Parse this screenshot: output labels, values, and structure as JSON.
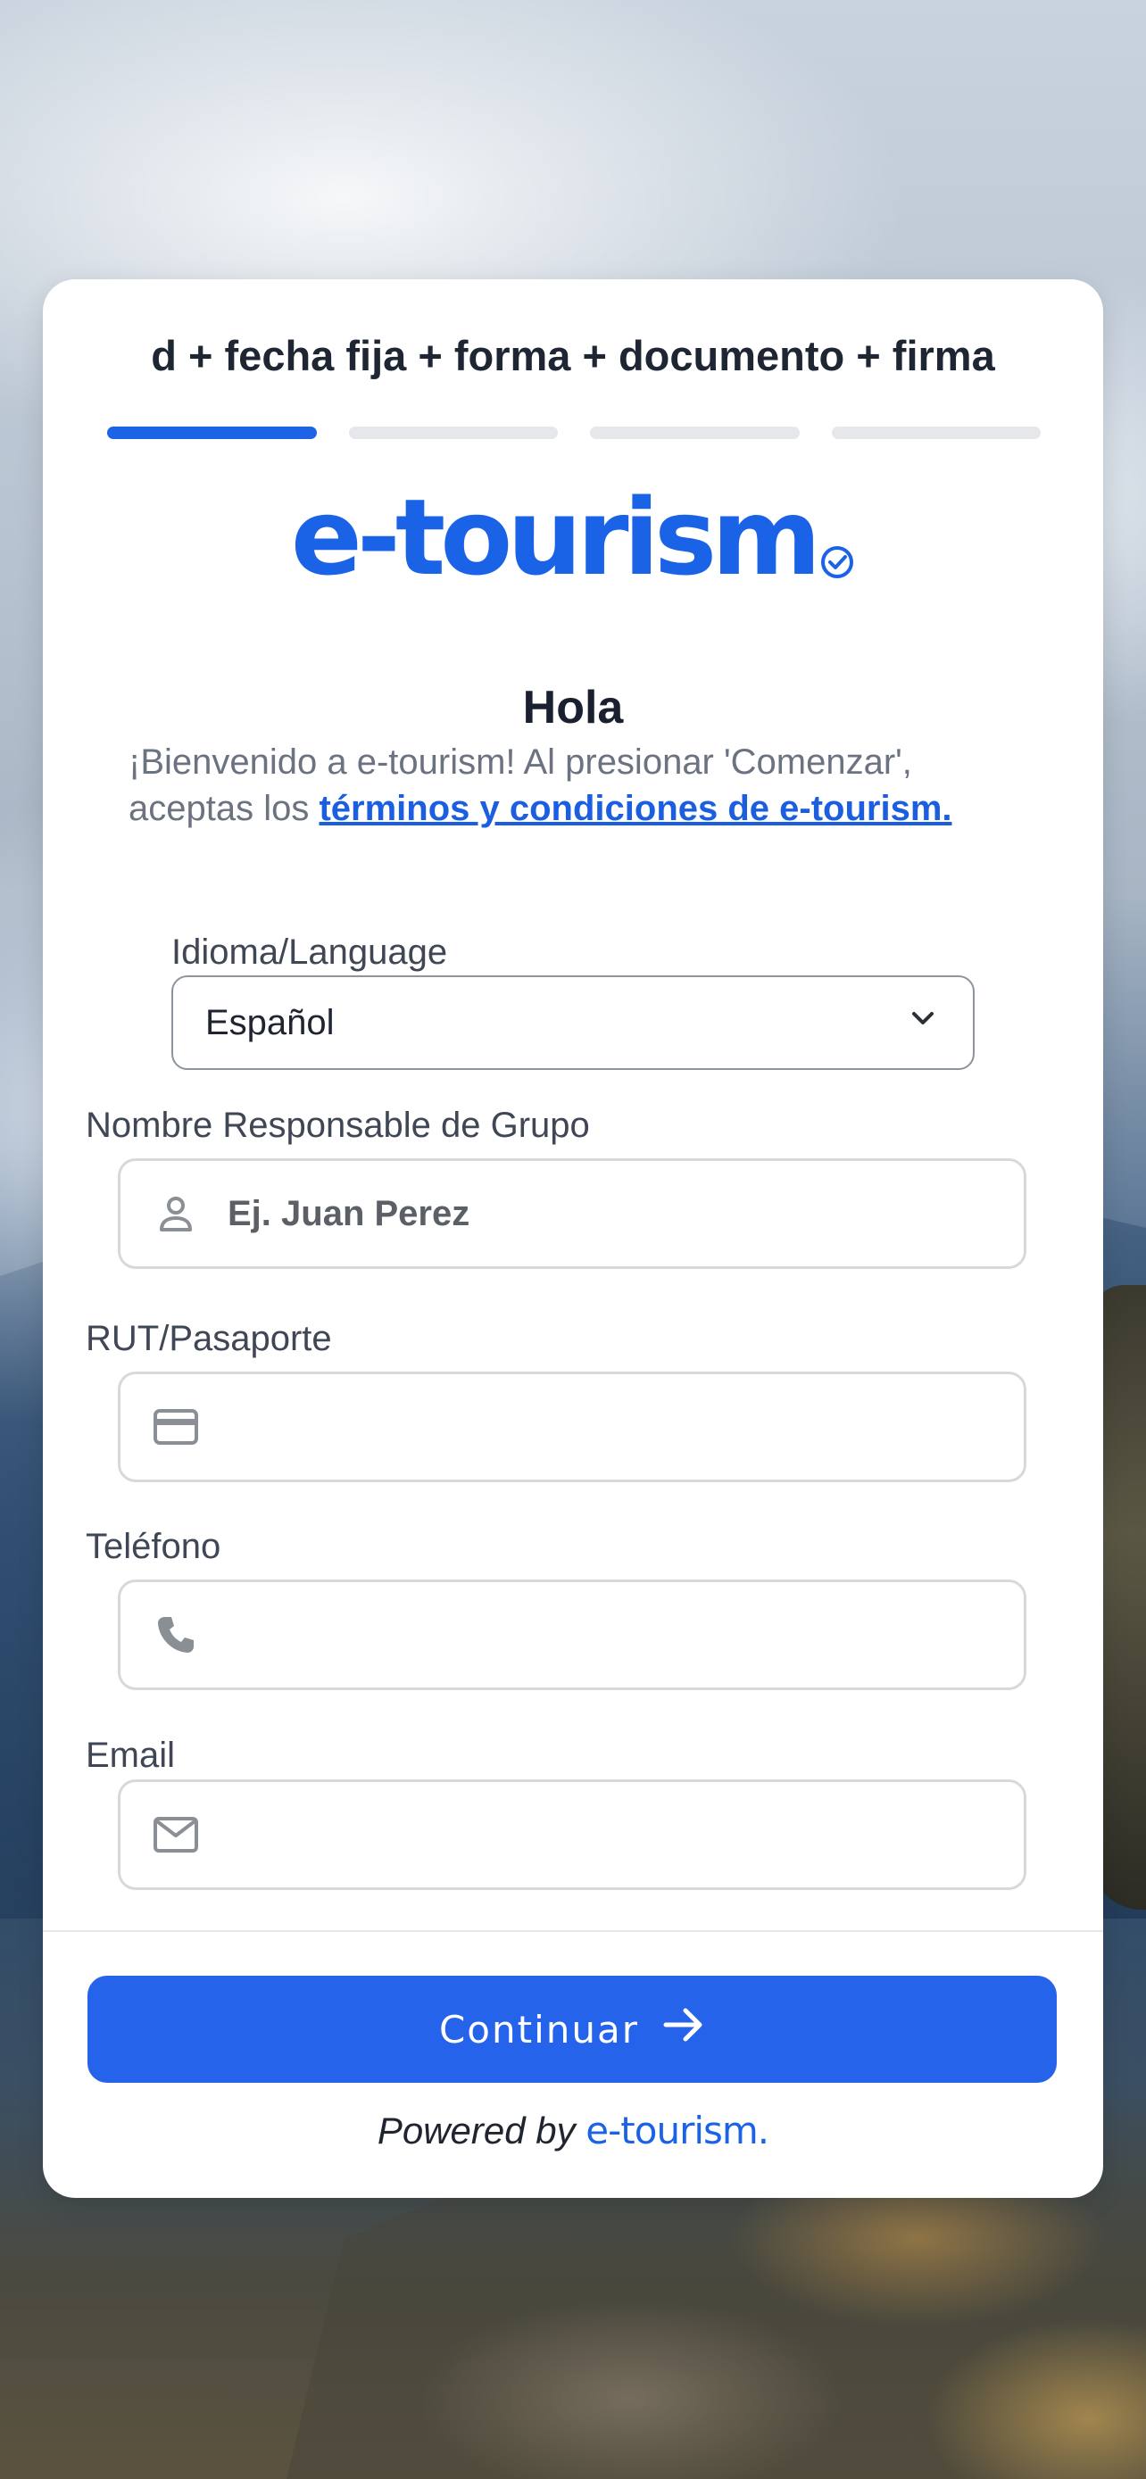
{
  "header": {
    "step_title": "d + fecha fija + forma + documento + firma",
    "progress_steps": 4,
    "progress_active": 1
  },
  "logo": {
    "text": "e-tourism",
    "icon": "check-badge-icon"
  },
  "greeting": {
    "title": "Hola",
    "intro_text": "¡Bienvenido a e-tourism! Al presionar 'Comenzar', aceptas los ",
    "terms_link": "términos y condiciones de e-tourism."
  },
  "language": {
    "label": "Idioma/Language",
    "selected": "Español"
  },
  "fields": {
    "name": {
      "label": "Nombre Responsable de Grupo",
      "placeholder": "Ej. Juan Perez",
      "value": "",
      "icon": "person-icon"
    },
    "rut": {
      "label": "RUT/Pasaporte",
      "placeholder": "",
      "value": "",
      "icon": "card-icon"
    },
    "phone": {
      "label": "Teléfono",
      "placeholder": "",
      "value": "",
      "icon": "phone-icon"
    },
    "email": {
      "label": "Email",
      "placeholder": "",
      "value": "",
      "icon": "mail-icon"
    }
  },
  "actions": {
    "continue_label": "Continuar"
  },
  "footer": {
    "powered_by": "Powered by",
    "brand": "e-tourism."
  },
  "colors": {
    "accent": "#2563eb",
    "brand": "#1b63e6",
    "text": "#1f2633"
  }
}
